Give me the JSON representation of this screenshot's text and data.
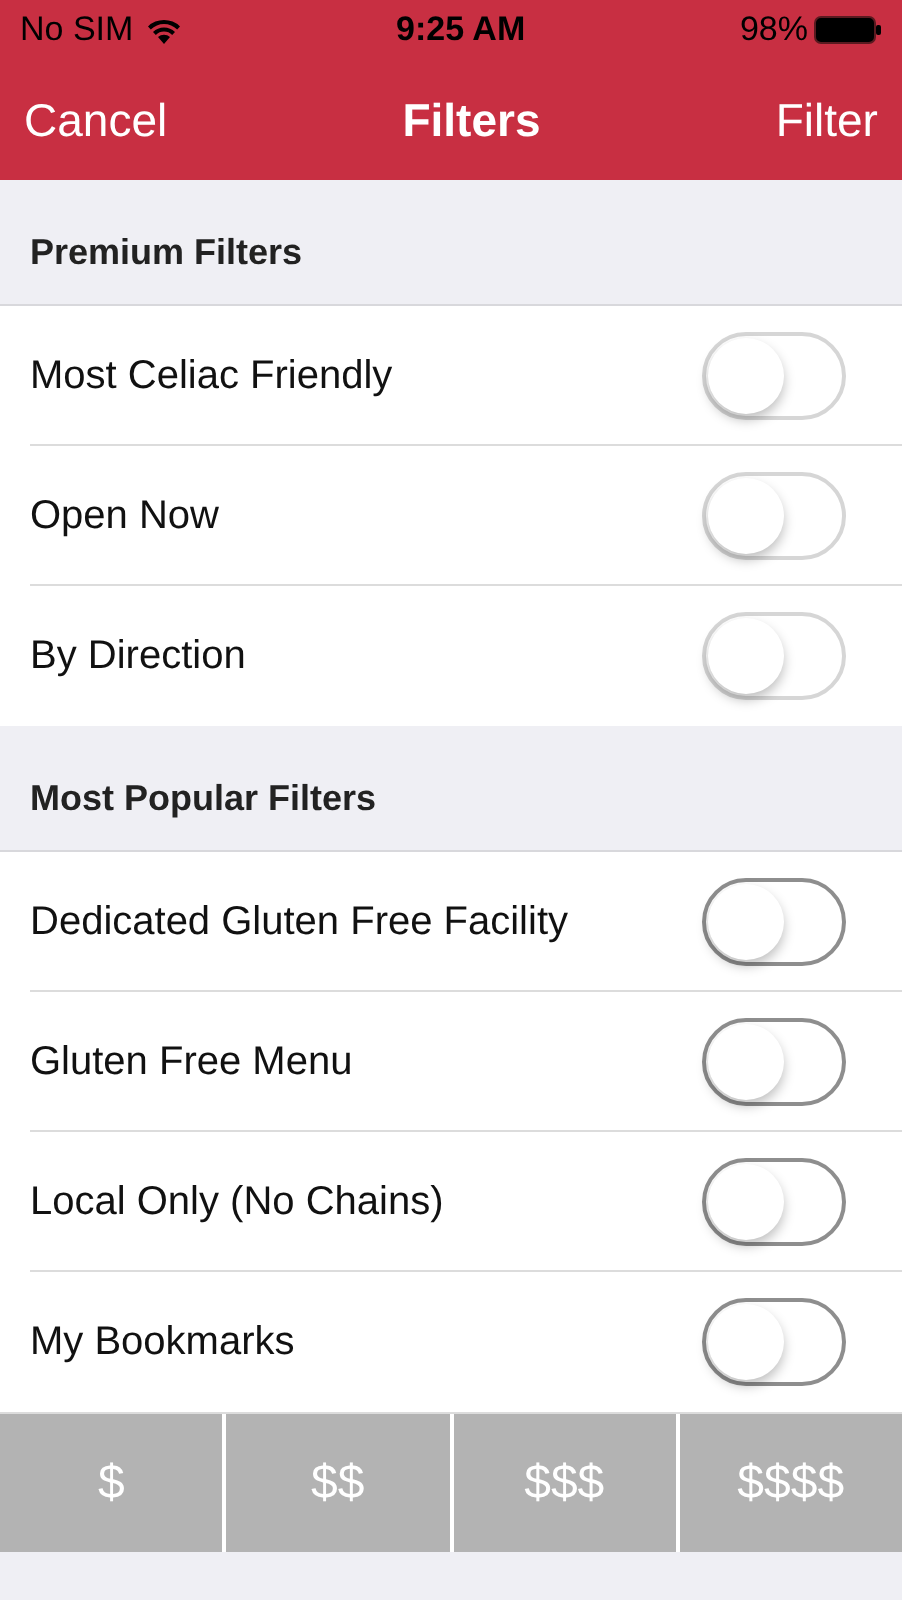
{
  "status_bar": {
    "carrier": "No SIM",
    "time": "9:25 AM",
    "battery": "98%"
  },
  "nav": {
    "left": "Cancel",
    "title": "Filters",
    "right": "Filter"
  },
  "sections": [
    {
      "title": "Premium Filters",
      "rows": [
        {
          "label": "Most Celiac Friendly",
          "on": false,
          "disabled": true
        },
        {
          "label": "Open Now",
          "on": false,
          "disabled": true
        },
        {
          "label": "By Direction",
          "on": false,
          "disabled": true
        }
      ]
    },
    {
      "title": "Most Popular Filters",
      "rows": [
        {
          "label": "Dedicated Gluten Free Facility",
          "on": false,
          "disabled": false
        },
        {
          "label": "Gluten Free Menu",
          "on": false,
          "disabled": false
        },
        {
          "label": "Local Only (No Chains)",
          "on": false,
          "disabled": false
        },
        {
          "label": "My Bookmarks",
          "on": false,
          "disabled": false
        }
      ]
    }
  ],
  "prices": [
    {
      "label": "$",
      "selected": false
    },
    {
      "label": "$$",
      "selected": false
    },
    {
      "label": "$$$",
      "selected": false
    },
    {
      "label": "$$$$",
      "selected": false
    }
  ]
}
